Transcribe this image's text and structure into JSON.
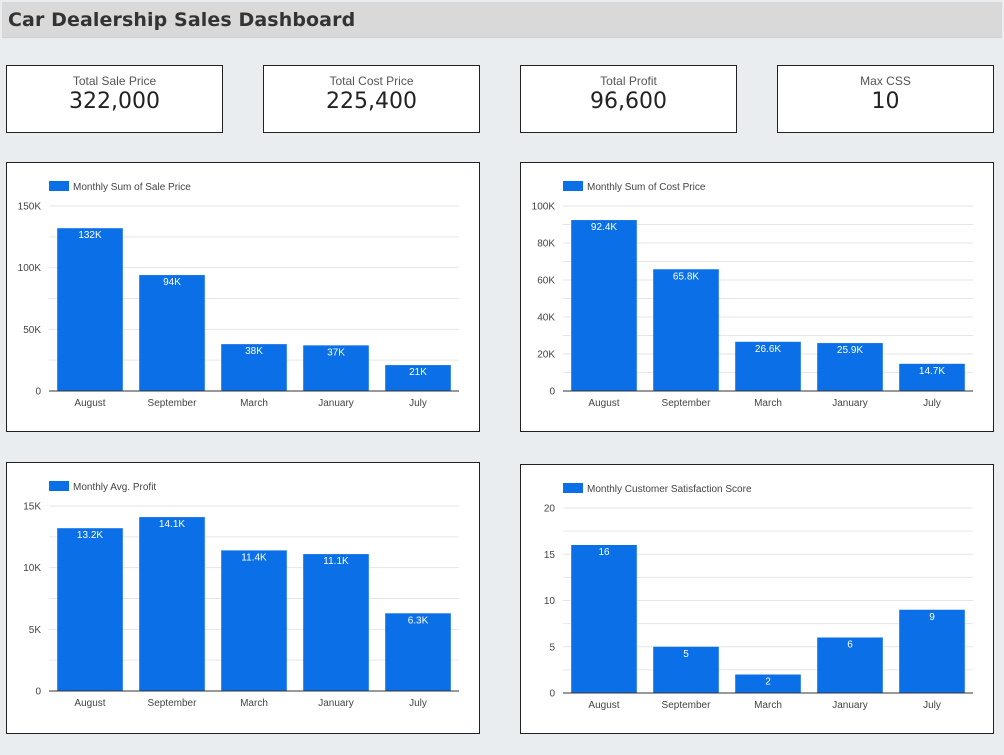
{
  "header": {
    "title": "Car Dealership Sales Dashboard"
  },
  "kpis": [
    {
      "label": "Total Sale Price",
      "value": "322,000"
    },
    {
      "label": "Total Cost Price",
      "value": "225,400"
    },
    {
      "label": "Total Profit",
      "value": "96,600"
    },
    {
      "label": "Max CSS",
      "value": "10"
    }
  ],
  "colors": {
    "bar": "#0b6fe8",
    "grid": "#e6e6e6",
    "axis": "#333333"
  },
  "chart_data": [
    {
      "type": "bar",
      "categories": [
        "August",
        "September",
        "March",
        "January",
        "July"
      ],
      "series": [
        {
          "name": "Monthly Sum of Sale Price",
          "values": [
            132000,
            94000,
            38000,
            37000,
            21000
          ]
        }
      ],
      "data_labels": [
        "132K",
        "94K",
        "38K",
        "37K",
        "21K"
      ],
      "yticks": [
        "0",
        "50K",
        "100K",
        "150K"
      ],
      "ylim": [
        0,
        150000
      ],
      "minor_gridlines": true,
      "legend": "top-left"
    },
    {
      "type": "bar",
      "categories": [
        "August",
        "September",
        "March",
        "January",
        "July"
      ],
      "series": [
        {
          "name": "Monthly Sum of Cost Price",
          "values": [
            92400,
            65800,
            26600,
            25900,
            14700
          ]
        }
      ],
      "data_labels": [
        "92.4K",
        "65.8K",
        "26.6K",
        "25.9K",
        "14.7K"
      ],
      "yticks": [
        "0",
        "20K",
        "40K",
        "60K",
        "80K",
        "100K"
      ],
      "ylim": [
        0,
        100000
      ],
      "minor_gridlines": true,
      "legend": "top-left"
    },
    {
      "type": "bar",
      "categories": [
        "August",
        "September",
        "March",
        "January",
        "July"
      ],
      "series": [
        {
          "name": "Monthly Avg. Profit",
          "values": [
            13200,
            14100,
            11400,
            11100,
            6300
          ]
        }
      ],
      "data_labels": [
        "13.2K",
        "14.1K",
        "11.4K",
        "11.1K",
        "6.3K"
      ],
      "yticks": [
        "0",
        "5K",
        "10K",
        "15K"
      ],
      "ylim": [
        0,
        15000
      ],
      "minor_gridlines": true,
      "legend": "top-left"
    },
    {
      "type": "bar",
      "categories": [
        "August",
        "September",
        "March",
        "January",
        "July"
      ],
      "series": [
        {
          "name": "Monthly Customer Satisfaction Score",
          "values": [
            16,
            5,
            2,
            6,
            9
          ]
        }
      ],
      "data_labels": [
        "16",
        "5",
        "2",
        "6",
        "9"
      ],
      "yticks": [
        "0",
        "5",
        "10",
        "15",
        "20"
      ],
      "ylim": [
        0,
        20
      ],
      "minor_gridlines": true,
      "legend": "top-left"
    }
  ]
}
